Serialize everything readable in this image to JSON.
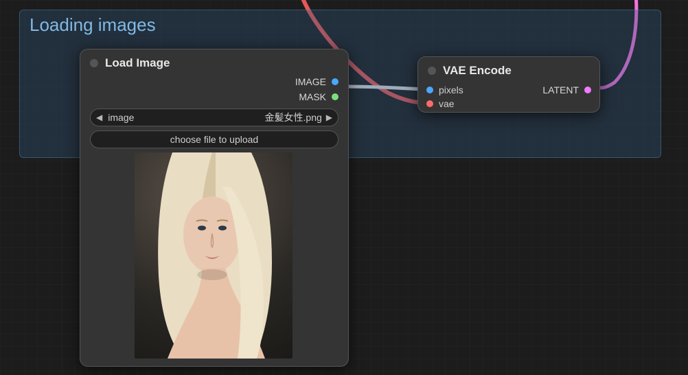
{
  "group": {
    "title": "Loading images"
  },
  "load_image": {
    "title": "Load Image",
    "outputs": {
      "image": "IMAGE",
      "mask": "MASK"
    },
    "widget_label": "image",
    "widget_value": "金髪女性.png",
    "upload_button": "choose file to upload"
  },
  "vae_encode": {
    "title": "VAE Encode",
    "inputs": {
      "pixels": "pixels",
      "vae": "vae"
    },
    "outputs": {
      "latent": "LATENT"
    }
  },
  "colors": {
    "image_port": "#4aa8ff",
    "mask_port": "#7be07b",
    "vae_port": "#ff6b6b",
    "latent_port": "#f07bff"
  }
}
